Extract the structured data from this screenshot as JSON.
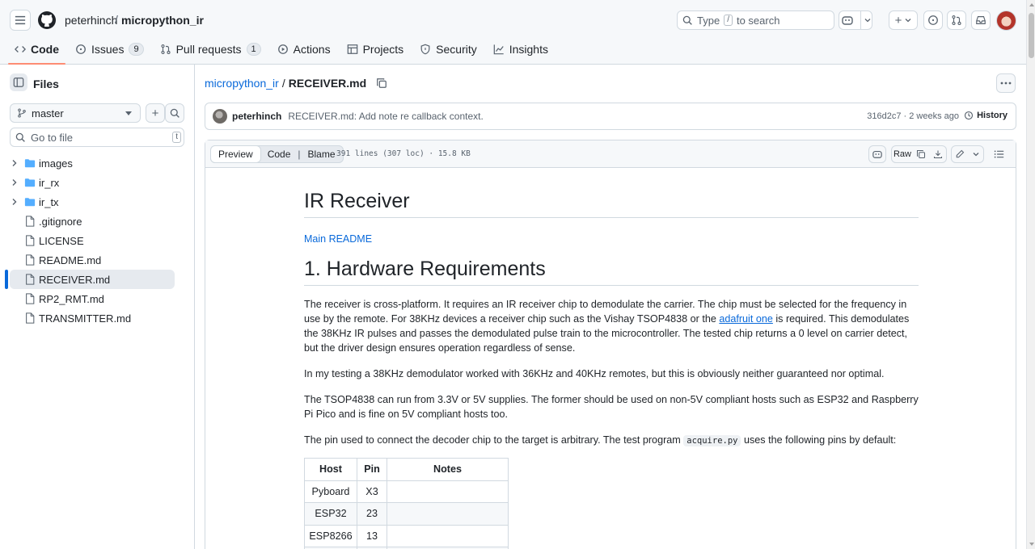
{
  "header": {
    "owner": "peterhinch",
    "separator": "/",
    "repo": "micropython_ir",
    "search_placeholder_pre": "Type",
    "search_key": "/",
    "search_placeholder_post": "to search"
  },
  "tabs": [
    {
      "label": "Code",
      "icon": "code-icon",
      "selected": true
    },
    {
      "label": "Issues",
      "icon": "issue-icon",
      "count": "9"
    },
    {
      "label": "Pull requests",
      "icon": "pull-request-icon",
      "count": "1"
    },
    {
      "label": "Actions",
      "icon": "play-icon"
    },
    {
      "label": "Projects",
      "icon": "table-icon"
    },
    {
      "label": "Security",
      "icon": "shield-icon"
    },
    {
      "label": "Insights",
      "icon": "graph-icon"
    }
  ],
  "sidebar": {
    "title": "Files",
    "branch": "master",
    "goto_placeholder": "Go to file",
    "goto_key": "t",
    "tree": [
      {
        "name": "images",
        "type": "folder"
      },
      {
        "name": "ir_rx",
        "type": "folder"
      },
      {
        "name": "ir_tx",
        "type": "folder"
      },
      {
        "name": ".gitignore",
        "type": "file"
      },
      {
        "name": "LICENSE",
        "type": "file"
      },
      {
        "name": "README.md",
        "type": "file"
      },
      {
        "name": "RECEIVER.md",
        "type": "file",
        "active": true
      },
      {
        "name": "RP2_RMT.md",
        "type": "file"
      },
      {
        "name": "TRANSMITTER.md",
        "type": "file"
      }
    ]
  },
  "path": {
    "repo": "micropython_ir",
    "separator": "/",
    "file": "RECEIVER.md"
  },
  "commit": {
    "author": "peterhinch",
    "message": "RECEIVER.md: Add note re callback context.",
    "sha_time": "316d2c7 · 2 weeks ago",
    "history_label": "History"
  },
  "filebar": {
    "preview": "Preview",
    "code": "Code",
    "blame": "Blame",
    "info": "391 lines (307 loc) · 15.8 KB",
    "raw": "Raw"
  },
  "doc": {
    "h1": "IR Receiver",
    "main_link": "Main README",
    "h2": "1. Hardware Requirements",
    "p1_a": "The receiver is cross-platform. It requires an IR receiver chip to demodulate the carrier. The chip must be selected for the frequency in use by the remote. For 38KHz devices a receiver chip such as the Vishay TSOP4838 or the ",
    "p1_link": "adafruit one",
    "p1_b": " is required. This demodulates the 38KHz IR pulses and passes the demodulated pulse train to the microcontroller. The tested chip returns a 0 level on carrier detect, but the driver design ensures operation regardless of sense.",
    "p2": "In my testing a 38KHz demodulator worked with 36KHz and 40KHz remotes, but this is obviously neither guaranteed nor optimal.",
    "p3": "The TSOP4838 can run from 3.3V or 5V supplies. The former should be used on non-5V compliant hosts such as ESP32 and Raspberry Pi Pico and is fine on 5V compliant hosts too.",
    "p4_a": "The pin used to connect the decoder chip to the target is arbitrary. The test program ",
    "p4_code": "acquire.py",
    "p4_b": " uses the following pins by default:",
    "table_headers": [
      "Host",
      "Pin",
      "Notes"
    ],
    "table_rows": [
      [
        "Pyboard",
        "X3",
        ""
      ],
      [
        "ESP32",
        "23",
        ""
      ],
      [
        "ESP8266",
        "13",
        ""
      ],
      [
        "",
        "",
        ""
      ]
    ]
  }
}
